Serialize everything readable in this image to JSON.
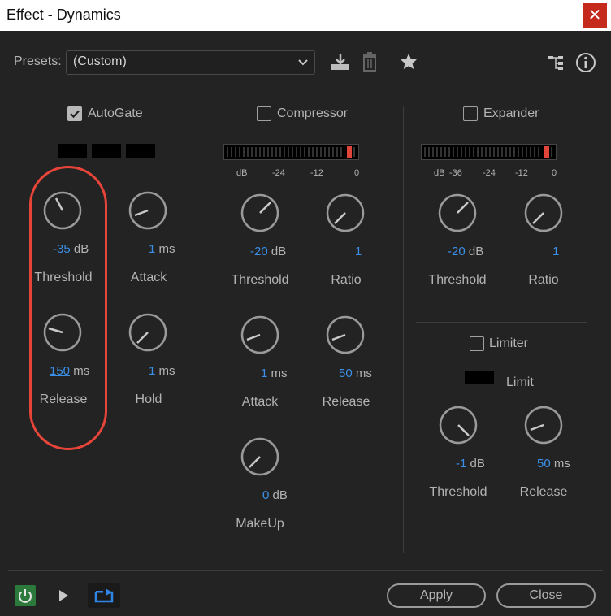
{
  "window": {
    "title": "Effect - Dynamics",
    "close_glyph": "✕"
  },
  "presets": {
    "label": "Presets:",
    "value": "(Custom)"
  },
  "autogate": {
    "label": "AutoGate",
    "enabled": true,
    "threshold": {
      "value": "-35",
      "unit": "dB",
      "label": "Threshold"
    },
    "attack": {
      "value": "1",
      "unit": "ms",
      "label": "Attack"
    },
    "release": {
      "value": "150",
      "unit": "ms",
      "label": "Release"
    },
    "hold": {
      "value": "1",
      "unit": "ms",
      "label": "Hold"
    }
  },
  "compressor": {
    "label": "Compressor",
    "enabled": false,
    "meter_ticks": [
      "dB",
      "-24",
      "-12",
      "0"
    ],
    "threshold": {
      "value": "-20",
      "unit": "dB",
      "label": "Threshold"
    },
    "ratio": {
      "value": "1",
      "label": "Ratio"
    },
    "attack": {
      "value": "1",
      "unit": "ms",
      "label": "Attack"
    },
    "release": {
      "value": "50",
      "unit": "ms",
      "label": "Release"
    },
    "makeup": {
      "value": "0",
      "unit": "dB",
      "label": "MakeUp"
    }
  },
  "expander": {
    "label": "Expander",
    "enabled": false,
    "meter_ticks": [
      "dB",
      "-36",
      "-24",
      "-12",
      "0"
    ],
    "threshold": {
      "value": "-20",
      "unit": "dB",
      "label": "Threshold"
    },
    "ratio": {
      "value": "1",
      "label": "Ratio"
    }
  },
  "limiter": {
    "label": "Limiter",
    "enabled": false,
    "limit_label": "Limit",
    "threshold": {
      "value": "-1",
      "unit": "dB",
      "label": "Threshold"
    },
    "release": {
      "value": "50",
      "unit": "ms",
      "label": "Release"
    }
  },
  "footer": {
    "apply": "Apply",
    "close": "Close"
  },
  "colors": {
    "accent_value": "#3a8fe6",
    "power_on": "#2b7a3b",
    "annotation": "#e8453a",
    "meter_peak": "#e0453a"
  }
}
